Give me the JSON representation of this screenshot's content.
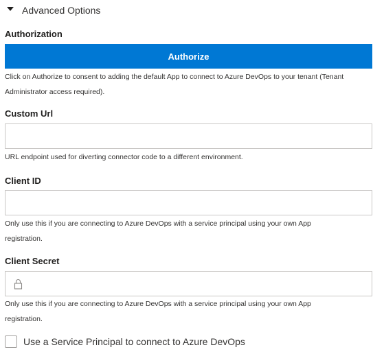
{
  "advanced_options": {
    "label": "Advanced Options"
  },
  "authorization": {
    "label": "Authorization",
    "button_label": "Authorize",
    "help_line1": "Click on Authorize to consent to adding the default App to connect to Azure DevOps to your tenant (Tenant",
    "help_line2": "Administrator access required)."
  },
  "custom_url": {
    "label": "Custom Url",
    "value": "",
    "help": "URL endpoint used for diverting connector code to a different environment."
  },
  "client_id": {
    "label": "Client ID",
    "value": "",
    "help_line1": "Only use this if you are connecting to Azure DevOps with a service principal using your own App",
    "help_line2": "registration."
  },
  "client_secret": {
    "label": "Client Secret",
    "value": "",
    "icon": "lock-icon",
    "help_line1": "Only use this if you are connecting to Azure DevOps with a service principal using your own App",
    "help_line2": "registration."
  },
  "service_principal": {
    "label": "Use a Service Principal to connect to Azure DevOps",
    "checked": false
  },
  "colors": {
    "accent": "#0078d4",
    "border": "#c8c6c4",
    "text": "#323130"
  }
}
